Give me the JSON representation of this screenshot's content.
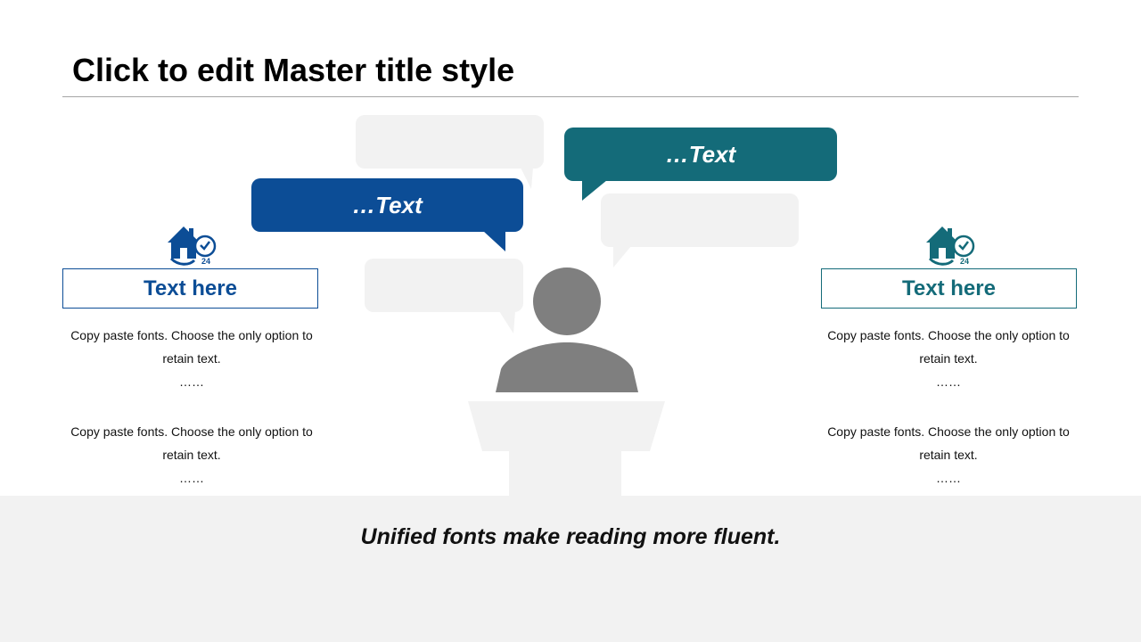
{
  "title": "Click to edit Master title style",
  "bubbles": {
    "blue": {
      "label": "…Text",
      "color": "#0c4d96"
    },
    "teal": {
      "label": "…Text",
      "color": "#146b79"
    }
  },
  "left_panel": {
    "icon": "home-24-hours-icon",
    "heading": "Text here",
    "accent": "#0c4d96",
    "paragraphs": [
      {
        "text": "Copy paste fonts. Choose the only option to retain text.",
        "ellipsis": "……"
      },
      {
        "text": "Copy paste fonts. Choose the only option to retain text.",
        "ellipsis": "……"
      }
    ]
  },
  "right_panel": {
    "icon": "home-24-hours-icon",
    "heading": "Text here",
    "accent": "#146b79",
    "paragraphs": [
      {
        "text": "Copy paste fonts. Choose the only option to retain text.",
        "ellipsis": "……"
      },
      {
        "text": "Copy paste fonts. Choose the only option to retain text.",
        "ellipsis": "……"
      }
    ]
  },
  "footer": {
    "text": "Unified fonts make reading more fluent."
  }
}
